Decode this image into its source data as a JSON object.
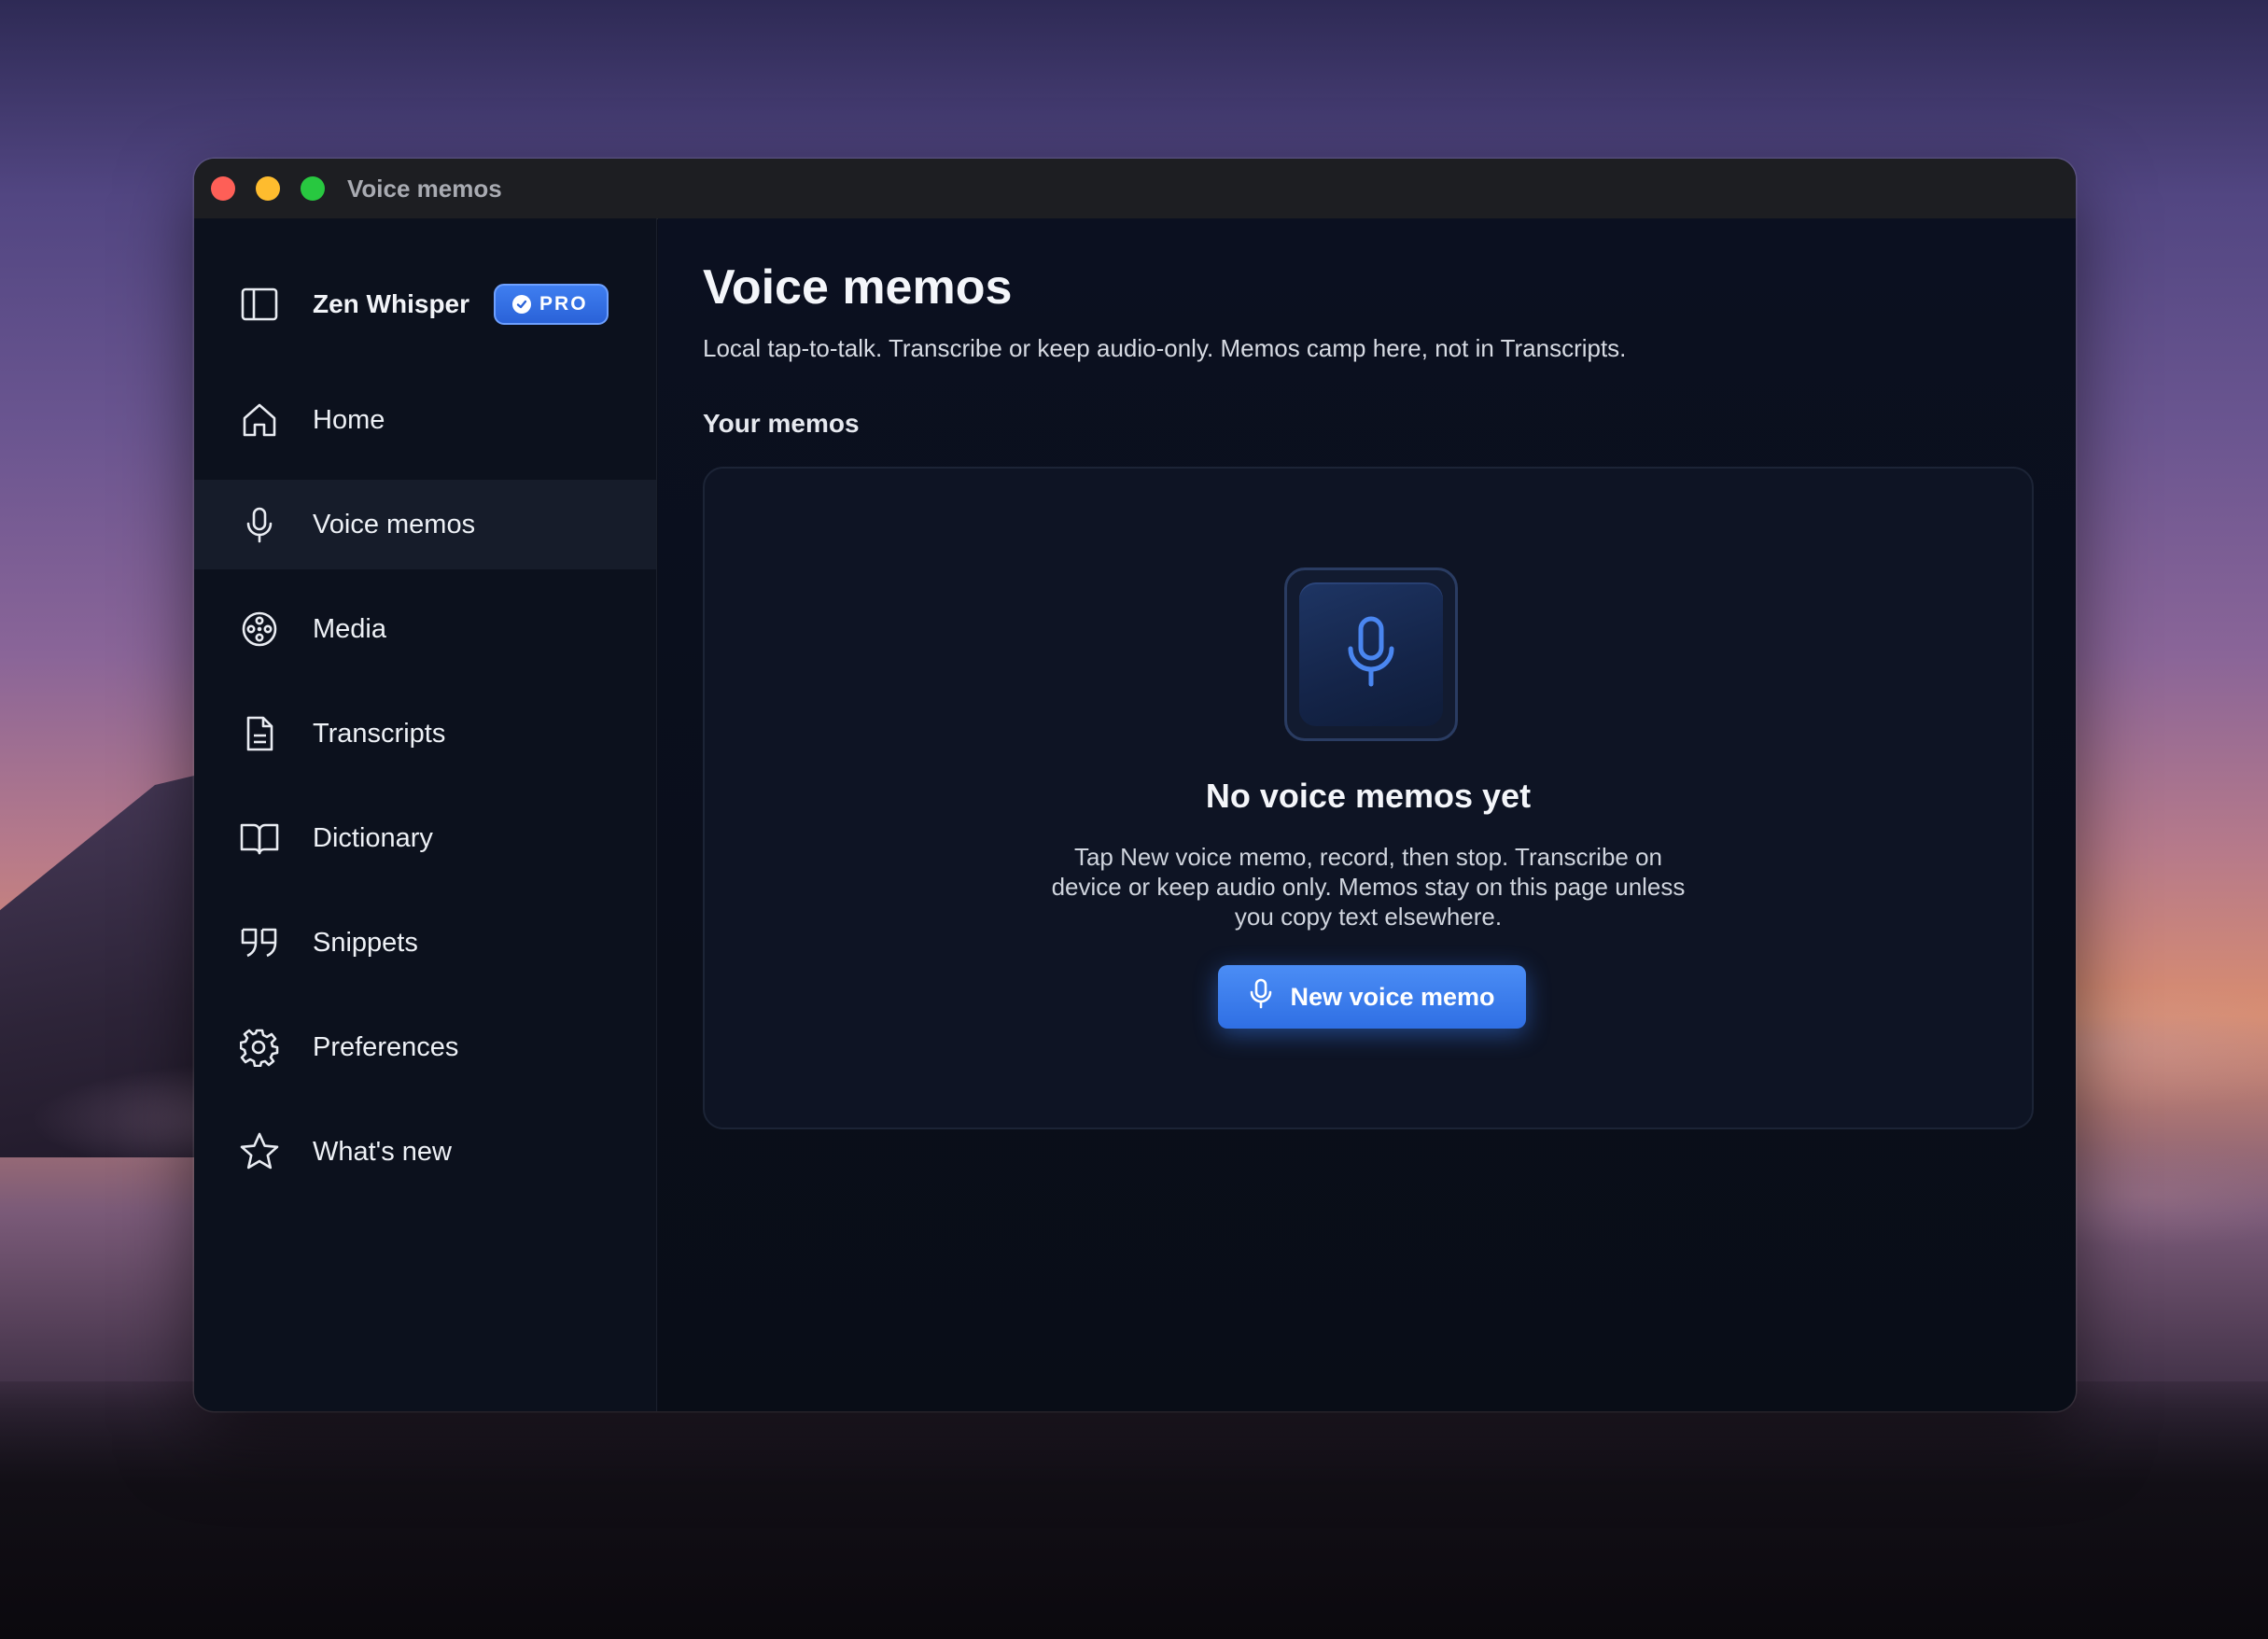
{
  "window": {
    "title": "Voice memos"
  },
  "sidebar": {
    "brand_name": "Zen Whisper",
    "badge": "PRO",
    "items": [
      {
        "label": "Home",
        "icon": "home-icon"
      },
      {
        "label": "Voice memos",
        "icon": "microphone-icon",
        "active": true
      },
      {
        "label": "Media",
        "icon": "film-reel-icon"
      },
      {
        "label": "Transcripts",
        "icon": "document-icon"
      },
      {
        "label": "Dictionary",
        "icon": "book-icon"
      },
      {
        "label": "Snippets",
        "icon": "quote-icon"
      },
      {
        "label": "Preferences",
        "icon": "gear-icon"
      },
      {
        "label": "What's new",
        "icon": "star-icon"
      }
    ]
  },
  "main": {
    "title": "Voice memos",
    "subtitle": "Local tap-to-talk. Transcribe or keep audio-only. Memos camp here, not in Transcripts.",
    "section_title": "Your memos",
    "empty_state": {
      "title": "No voice memos yet",
      "description": "Tap New voice memo, record, then stop. Transcribe on device or keep audio only. Memos stay on this page unless you copy text elsewhere.",
      "button_label": "New voice memo"
    }
  },
  "colors": {
    "accent": "#3b7ff0",
    "background": "#0b0f1a",
    "sidebar_active": "#161c2a"
  }
}
